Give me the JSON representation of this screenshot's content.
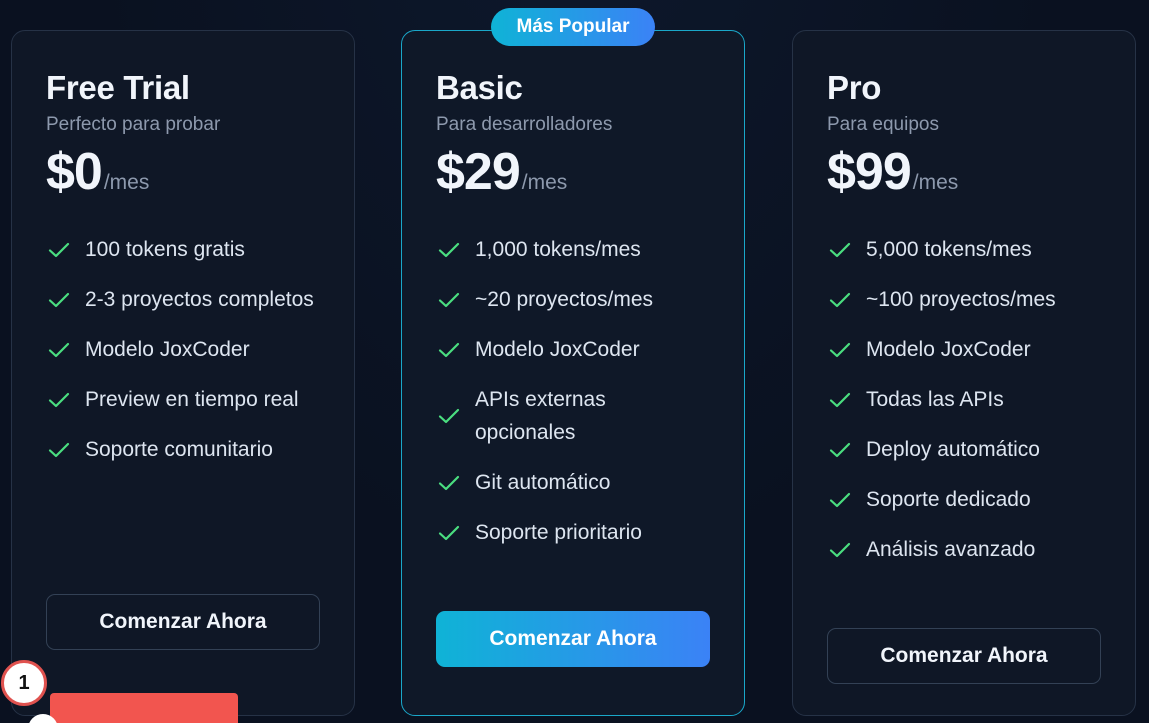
{
  "badge": {
    "label": "Más Popular"
  },
  "plans": [
    {
      "name": "Free Trial",
      "tagline": "Perfecto para probar",
      "price": "$0",
      "period": "/mes",
      "features": [
        "100 tokens gratis",
        "2-3 proyectos completos",
        "Modelo JoxCoder",
        "Preview en tiempo real",
        "Soporte comunitario"
      ],
      "cta": "Comenzar Ahora"
    },
    {
      "name": "Basic",
      "tagline": "Para desarrolladores",
      "price": "$29",
      "period": "/mes",
      "features": [
        "1,000 tokens/mes",
        "~20 proyectos/mes",
        "Modelo JoxCoder",
        "APIs externas opcionales",
        "Git automático",
        "Soporte prioritario"
      ],
      "cta": "Comenzar Ahora"
    },
    {
      "name": "Pro",
      "tagline": "Para equipos",
      "price": "$99",
      "period": "/mes",
      "features": [
        "5,000 tokens/mes",
        "~100 proyectos/mes",
        "Modelo JoxCoder",
        "Todas las APIs",
        "Deploy automático",
        "Soporte dedicado",
        "Análisis avanzado"
      ],
      "cta": "Comenzar Ahora"
    }
  ],
  "overlay": {
    "marker_label": "1"
  },
  "colors": {
    "accent_start": "#0fb3d6",
    "accent_end": "#3b82f6",
    "check": "#4ade80",
    "card_border": "#263246",
    "featured_border": "#1aa7c9",
    "overlay_red": "#f2554f"
  },
  "icons": {
    "feature": "check-icon"
  }
}
